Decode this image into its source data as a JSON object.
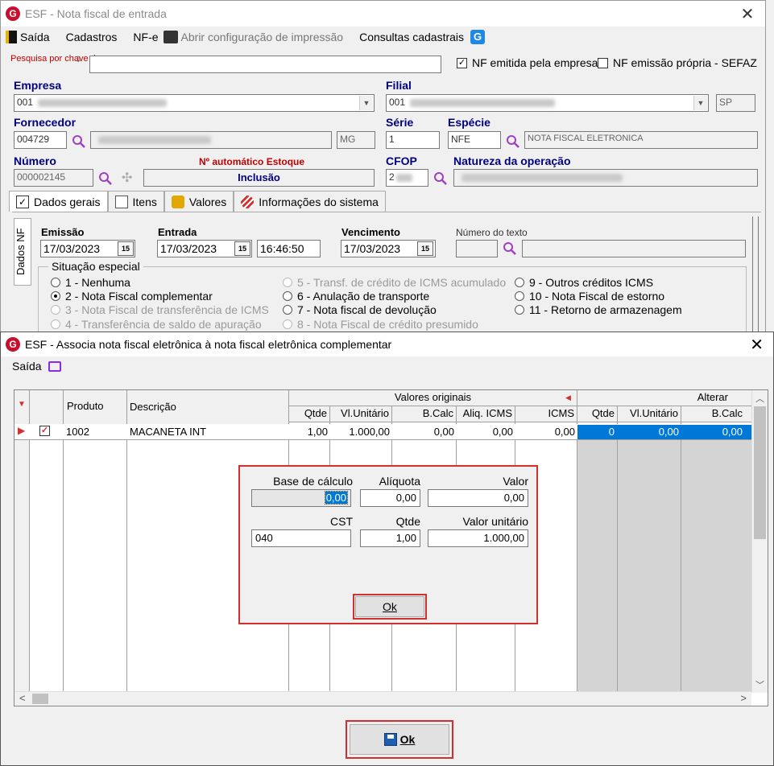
{
  "main": {
    "title": "ESF - Nota fiscal de entrada",
    "menu": {
      "saida": "Saída",
      "cadastros": "Cadastros",
      "nfe": "NF-e",
      "abrir_config": "Abrir configuração de impressão",
      "consultas": "Consultas cadastrais"
    },
    "search": {
      "label": "Pesquisa por chave de acesso",
      "value": ""
    },
    "chk_nf_empresa": {
      "label": "NF emitida pela empresa",
      "checked": true
    },
    "chk_nf_propria": {
      "label": "NF emissão própria - SEFAZ",
      "checked": false
    },
    "empresa": {
      "label": "Empresa",
      "code": "001"
    },
    "filial": {
      "label": "Filial",
      "code": "001",
      "uf": "SP"
    },
    "fornecedor": {
      "label": "Fornecedor",
      "code": "004729",
      "uf": "MG"
    },
    "serie": {
      "label": "Série",
      "value": "1"
    },
    "especie": {
      "label": "Espécie",
      "code": "NFE",
      "desc": "NOTA FISCAL ELETRONICA"
    },
    "numero": {
      "label": "Número",
      "value": "000002145"
    },
    "auto_estoque": {
      "label": "Nº automático Estoque",
      "value": "Inclusão"
    },
    "cfop": {
      "label": "CFOP",
      "value": "2"
    },
    "natureza": {
      "label": "Natureza da operação"
    },
    "tabs": [
      "Dados gerais",
      "Itens",
      "Valores",
      "Informações do sistema"
    ],
    "side_tab": "Dados NF",
    "emissao": {
      "label": "Emissão",
      "value": "17/03/2023"
    },
    "entrada": {
      "label": "Entrada",
      "date": "17/03/2023",
      "time": "16:46:50"
    },
    "vencimento": {
      "label": "Vencimento",
      "value": "17/03/2023"
    },
    "numero_texto": {
      "label": "Número do texto"
    },
    "situacao": {
      "title": "Situação especial",
      "options": [
        "1 - Nenhuma",
        "2 - Nota Fiscal complementar",
        "3 - Nota Fiscal de transferência de ICMS",
        "4 - Transferência de saldo de apuração",
        "5 - Transf. de crédito de ICMS acumulado",
        "6 - Anulação de transporte",
        "7 - Nota fiscal de devolução",
        "8 - Nota Fiscal de crédito presumido",
        "9 - Outros créditos ICMS",
        "10 - Nota Fiscal de estorno",
        "11 - Retorno de armazenagem"
      ]
    }
  },
  "dialog": {
    "title": "ESF - Associa nota fiscal eletrônica à nota fiscal eletrônica complementar",
    "menu_saida": "Saída",
    "grid": {
      "headers": {
        "produto": "Produto",
        "descricao": "Descrição",
        "valores_originais": "Valores originais",
        "alterar": "Alterar",
        "qtde": "Qtde",
        "vl_unitario": "Vl.Unitário",
        "b_calc": "B.Calc",
        "aliq_icms": "Aliq. ICMS",
        "icms": "ICMS",
        "alt_qtde": "Qtde",
        "alt_vl_unitario": "Vl.Unitário",
        "alt_b_calc": "B.Calc"
      },
      "row": {
        "produto": "1002",
        "descricao": "MACANETA INT",
        "qtde": "1,00",
        "vl_unitario": "1.000,00",
        "b_calc": "0,00",
        "aliq_icms": "0,00",
        "icms": "0,00",
        "alt_qtde": "0",
        "alt_vl_unitario": "0,00",
        "alt_b_calc": "0,00"
      }
    },
    "popup": {
      "base_calculo": {
        "label": "Base de cálculo",
        "value": "0,00"
      },
      "aliquota": {
        "label": "Alíquota",
        "value": "0,00"
      },
      "valor": {
        "label": "Valor",
        "value": "0,00"
      },
      "cst": {
        "label": "CST",
        "value": "040"
      },
      "qtde": {
        "label": "Qtde",
        "value": "1,00"
      },
      "valor_unitario": {
        "label": "Valor unitário",
        "value": "1.000,00"
      },
      "ok": "Ok"
    },
    "ok_button": "Ok"
  },
  "colors": {
    "accent": "#0078d7",
    "highlight": "#d32f2f",
    "label_blue": "#000080"
  }
}
